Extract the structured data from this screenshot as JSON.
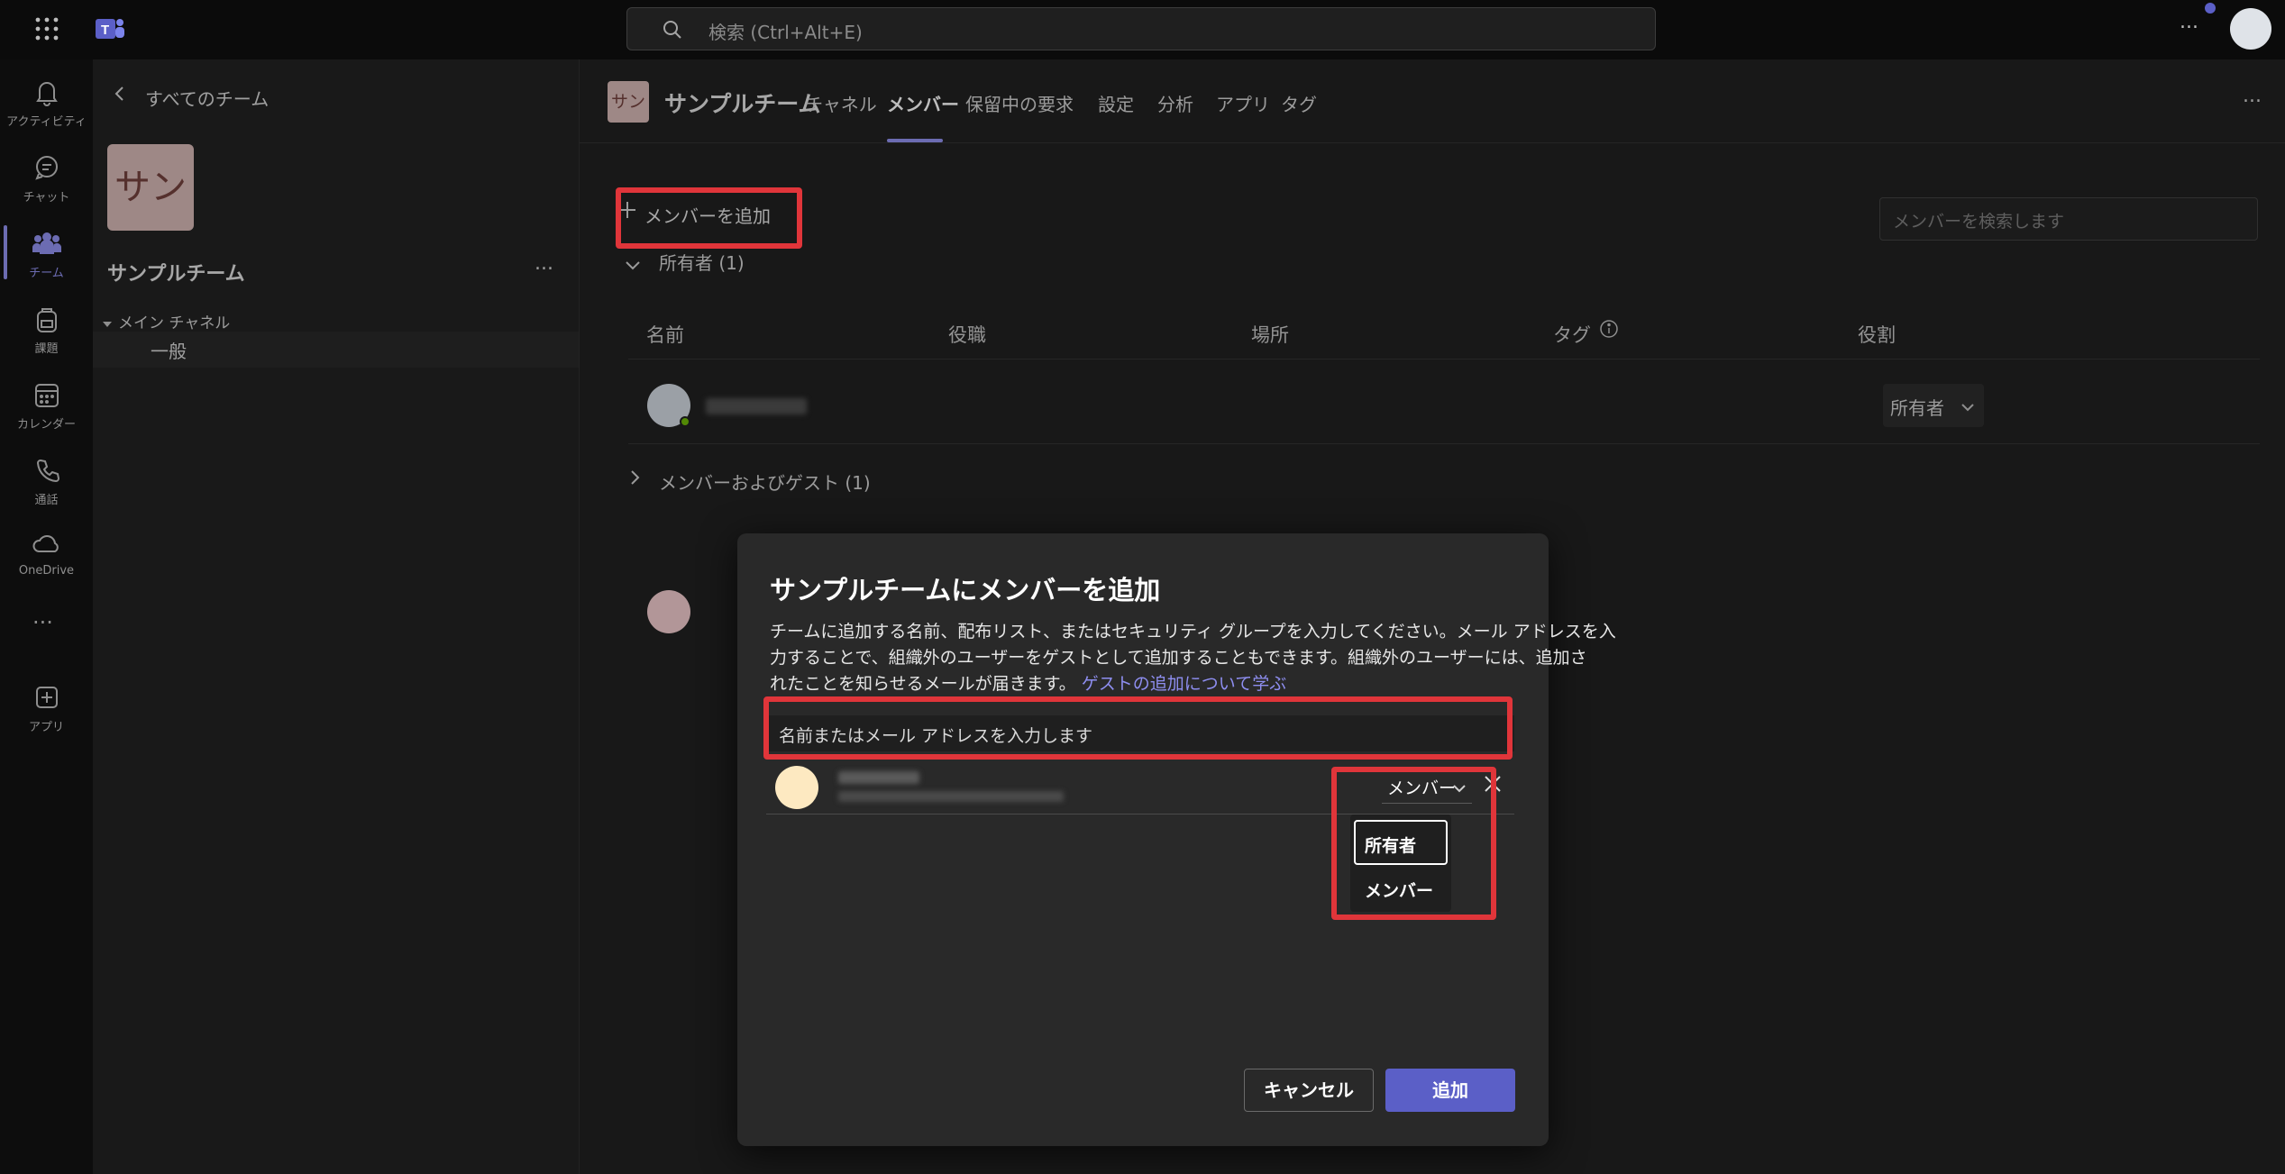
{
  "topbar": {
    "search_placeholder": "検索 (Ctrl+Alt+E)",
    "more": "..."
  },
  "rail": {
    "items": [
      {
        "label": "アクティビティ",
        "icon": "bell-icon"
      },
      {
        "label": "チャット",
        "icon": "chat-icon"
      },
      {
        "label": "チーム",
        "icon": "teams-icon",
        "active": true
      },
      {
        "label": "課題",
        "icon": "backpack-icon"
      },
      {
        "label": "カレンダー",
        "icon": "calendar-icon"
      },
      {
        "label": "通話",
        "icon": "phone-icon"
      },
      {
        "label": "OneDrive",
        "icon": "cloud-icon"
      },
      {
        "label": "アプリ",
        "icon": "add-app-icon"
      }
    ],
    "more": "..."
  },
  "teampanel": {
    "back_label": "すべてのチーム",
    "avatar_text": "サン",
    "team_name": "サンプルチーム",
    "more": "...",
    "channel_group": "メイン チャネル",
    "channel_general": "一般"
  },
  "header": {
    "avatar_text": "サン",
    "team_name": "サンプルチーム",
    "tabs": [
      "チャネル",
      "メンバー",
      "保留中の要求",
      "設定",
      "分析",
      "アプリ",
      "タグ"
    ],
    "active_tab": "メンバー",
    "more": "..."
  },
  "members": {
    "add_button": "メンバーを追加",
    "search_placeholder": "メンバーを検索します",
    "owners_section": "所有者 (1)",
    "columns": [
      "名前",
      "役職",
      "場所",
      "タグ",
      "役割"
    ],
    "owner_role": "所有者",
    "members_section": "メンバーおよびゲスト (1)"
  },
  "dialog": {
    "title": "サンプルチームにメンバーを追加",
    "desc_line1": "チームに追加する名前、配布リスト、またはセキュリティ グループを入力してください。メール アドレスを入",
    "desc_line2": "力することで、組織外のユーザーをゲストとして追加することもできます。組織外のユーザーには、追加さ",
    "desc_line3": "れたことを知らせるメールが届きます。",
    "learn_link": "ゲストの追加について学ぶ",
    "input_placeholder": "名前またはメール アドレスを入力します",
    "role_selected": "メンバー",
    "role_options": [
      "所有者",
      "メンバー"
    ],
    "cancel": "キャンセル",
    "add": "追加"
  },
  "colors": {
    "accent": "#5b5fc7",
    "highlight": "#e0353a",
    "link": "#8e8ef0"
  }
}
